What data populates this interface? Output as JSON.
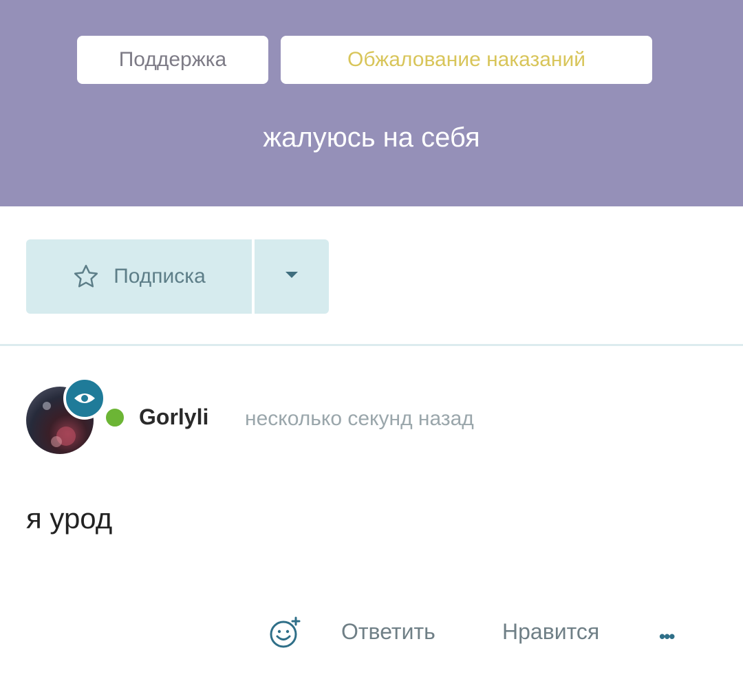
{
  "breadcrumb": {
    "items": [
      {
        "label": "Поддержка"
      },
      {
        "label": "Обжалование наказаний"
      }
    ]
  },
  "thread": {
    "title": "жалуюсь на себя"
  },
  "subscribe": {
    "label": "Подписка",
    "icon": "star-outline-icon",
    "dropdown_icon": "caret-down-icon"
  },
  "post": {
    "author": "Gorlyli",
    "time": "несколько секунд назад",
    "message": "я урод",
    "online": true
  },
  "actions": {
    "react_icon": "add-reaction-icon",
    "reply_label": "Ответить",
    "like_label": "Нравится",
    "more_label": "•••"
  },
  "colors": {
    "header_bg": "#9590b8",
    "accent": "#1f7b99",
    "online": "#6cb535",
    "breadcrumb_active": "#d8c55a"
  }
}
